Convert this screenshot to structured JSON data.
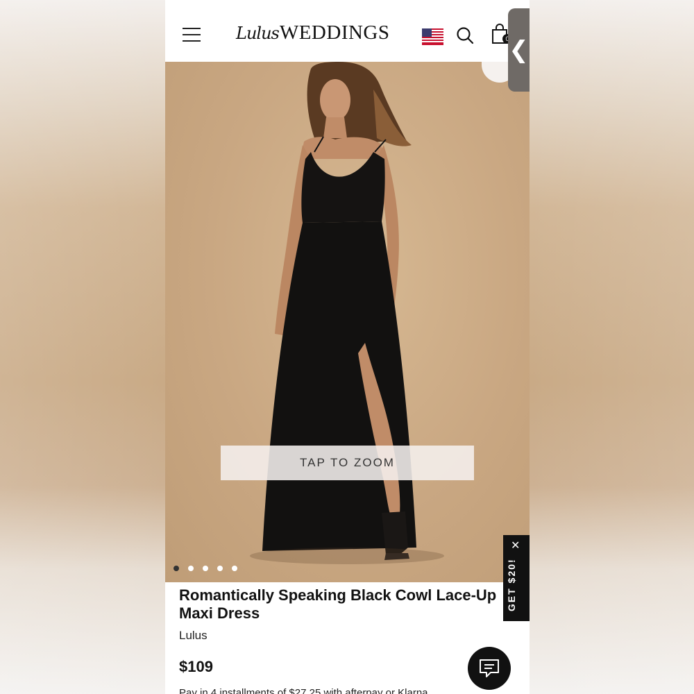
{
  "header": {
    "logo_script": "Lulus",
    "logo_word": "WEDDINGS",
    "bag_count": "0",
    "side_tab_glyph": "❮"
  },
  "gallery": {
    "zoom_label": "TAP TO ZOOM",
    "slide_count": 5,
    "active_slide": 1
  },
  "promo": {
    "label": "GET $20!",
    "close": "✕"
  },
  "product": {
    "title": "Romantically Speaking Black Cowl Lace-Up Maxi Dress",
    "brand": "Lulus",
    "price": "$109",
    "installments": "Pay in 4 installments of $27.25 with afterpay or Klarna"
  },
  "icons": {
    "menu": "hamburger-menu-icon",
    "flag": "us-flag-icon",
    "search": "search-icon",
    "bag": "shopping-bag-icon",
    "wishlist": "heart-icon",
    "chat": "chat-icon"
  },
  "colors": {
    "background_beige": "#c9a782",
    "dress_black": "#111111",
    "promo_black": "#111111"
  }
}
